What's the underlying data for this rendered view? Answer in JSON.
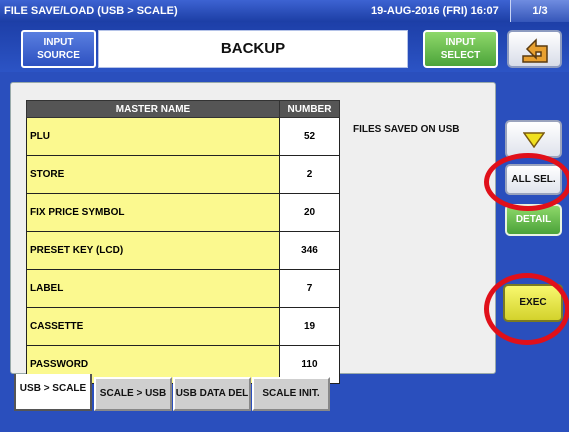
{
  "title_bar": {
    "title": "FILE SAVE/LOAD (USB > SCALE)",
    "datetime": "19-AUG-2016 (FRI) 16:07",
    "page": "1/3"
  },
  "header": {
    "input_source_label": "INPUT SOURCE",
    "source_value": "BACKUP",
    "input_select_label": "INPUT SELECT",
    "back_icon": "return-arrow-icon"
  },
  "table": {
    "col_name": "MASTER NAME",
    "col_number": "NUMBER",
    "rows": [
      {
        "name": "PLU",
        "number": "52"
      },
      {
        "name": "STORE",
        "number": "2"
      },
      {
        "name": "FIX PRICE SYMBOL",
        "number": "20"
      },
      {
        "name": "PRESET KEY (LCD)",
        "number": "346"
      },
      {
        "name": "LABEL",
        "number": "7"
      },
      {
        "name": "CASSETTE",
        "number": "19"
      },
      {
        "name": "PASSWORD",
        "number": "110"
      }
    ]
  },
  "files_label": "FILES SAVED ON USB",
  "side": {
    "down_icon": "triangle-down-icon",
    "all_sel": "ALL SEL.",
    "detail": "DETAIL",
    "exec": "EXEC"
  },
  "tabs": [
    {
      "label": "USB > SCALE",
      "active": true
    },
    {
      "label": "SCALE > USB",
      "active": false
    },
    {
      "label": "USB DATA DEL",
      "active": false
    },
    {
      "label": "SCALE INIT.",
      "active": false
    }
  ],
  "colors": {
    "header_blue": "#2a4fbd",
    "name_cell_yellow": "#fbf98f",
    "annotation_red": "#e0101a"
  }
}
